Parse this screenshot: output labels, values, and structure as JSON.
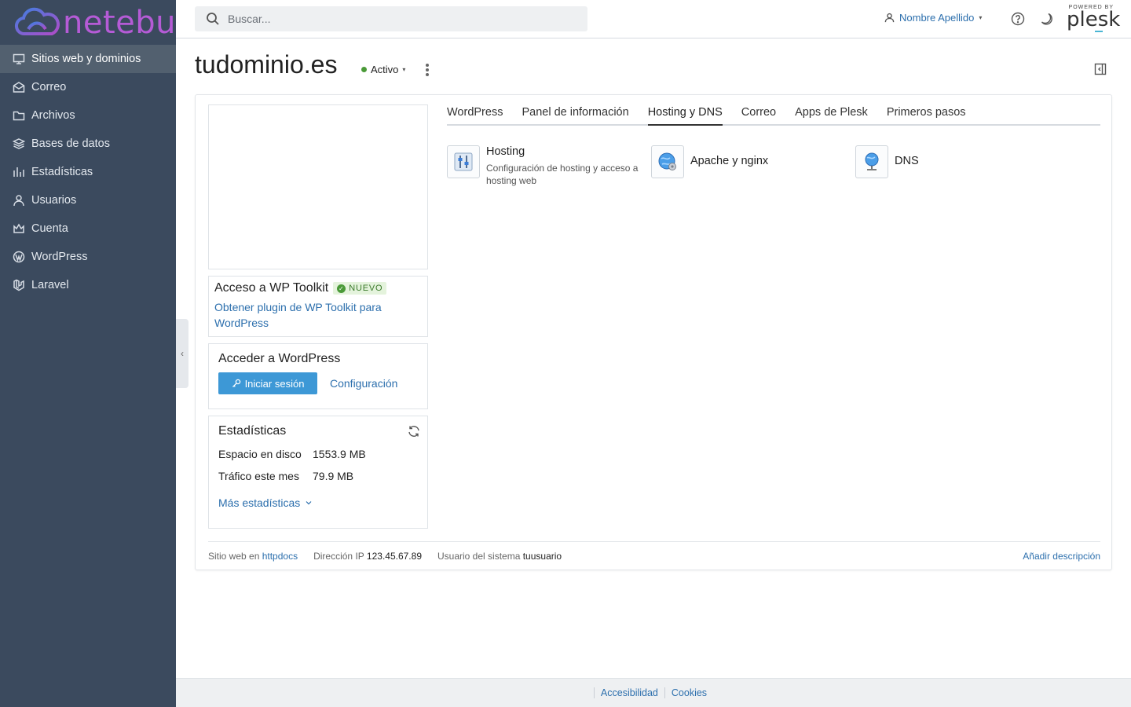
{
  "brand": {
    "logo_text": "netebu",
    "powered_by": "POWERED BY",
    "plesk": "plesk"
  },
  "sidebar": {
    "items": [
      {
        "label": "Sitios web y dominios",
        "icon": "monitor-icon",
        "active": true
      },
      {
        "label": "Correo",
        "icon": "mail-icon"
      },
      {
        "label": "Archivos",
        "icon": "folder-icon"
      },
      {
        "label": "Bases de datos",
        "icon": "database-icon"
      },
      {
        "label": "Estadísticas",
        "icon": "bar-chart-icon"
      },
      {
        "label": "Usuarios",
        "icon": "user-icon"
      },
      {
        "label": "Cuenta",
        "icon": "crown-icon"
      },
      {
        "label": "WordPress",
        "icon": "wordpress-icon"
      },
      {
        "label": "Laravel",
        "icon": "laravel-icon"
      }
    ]
  },
  "header": {
    "search_placeholder": "Buscar...",
    "user_name": "Nombre Apellido"
  },
  "domain": {
    "title": "tudominio.es",
    "status": "Activo",
    "status_color": "#4a9a38"
  },
  "wp_toolkit": {
    "title": "Acceso a WP Toolkit",
    "badge": "NUEVO",
    "link": "Obtener plugin de WP Toolkit para WordPress"
  },
  "wp_access": {
    "title": "Acceder a WordPress",
    "login_button": "Iniciar sesión",
    "config_link": "Configuración"
  },
  "stats": {
    "title": "Estadísticas",
    "disk_label": "Espacio en disco",
    "disk_value": "1553.9 MB",
    "traffic_label": "Tráfico este mes",
    "traffic_value": "79.9 MB",
    "more": "Más estadísticas"
  },
  "tabs": [
    {
      "label": "WordPress"
    },
    {
      "label": "Panel de información"
    },
    {
      "label": "Hosting y DNS",
      "active": true
    },
    {
      "label": "Correo"
    },
    {
      "label": "Apps de Plesk"
    },
    {
      "label": "Primeros pasos"
    }
  ],
  "tiles": {
    "hosting_title": "Hosting",
    "hosting_desc": "Configuración de hosting y acceso a hosting web",
    "apache_title": "Apache y nginx",
    "dns_title": "DNS"
  },
  "card_footer": {
    "site_label": "Sitio web en",
    "site_value": "httpdocs",
    "ip_label": "Dirección IP",
    "ip_value": "123.45.67.89",
    "user_label": "Usuario del sistema",
    "user_value": "tuusuario",
    "add_desc": "Añadir descripción"
  },
  "page_footer": {
    "accessibility": "Accesibilidad",
    "cookies": "Cookies"
  },
  "colors": {
    "accent": "#2c6fad",
    "sidebar_bg": "#3b4a5e",
    "primary_button": "#3d98d6",
    "logo": "#b55bd6"
  }
}
